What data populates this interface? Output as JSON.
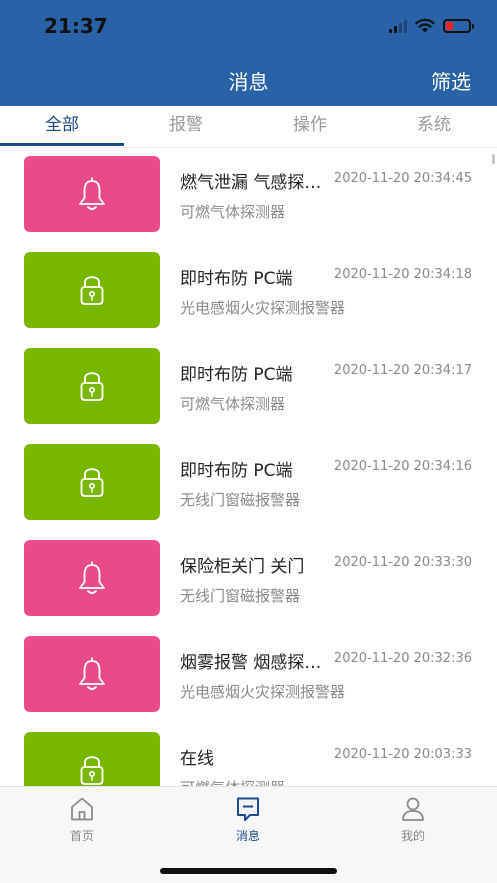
{
  "status_bar": {
    "time": "21:37",
    "battery_percent": 30
  },
  "header": {
    "title": "消息",
    "filter_label": "筛选"
  },
  "tabs": [
    {
      "label": "全部",
      "active": true
    },
    {
      "label": "报警",
      "active": false
    },
    {
      "label": "操作",
      "active": false
    },
    {
      "label": "系统",
      "active": false
    }
  ],
  "messages": [
    {
      "type": "alarm",
      "icon": "bell-icon",
      "title": "燃气泄漏  气感探测器",
      "time": "2020-11-20 20:34:45",
      "device": "可燃气体探测器"
    },
    {
      "type": "operation",
      "icon": "lock-icon",
      "title": "即时布防   PC端",
      "time": "2020-11-20 20:34:18",
      "device": "光电感烟火灾探测报警器"
    },
    {
      "type": "operation",
      "icon": "lock-icon",
      "title": "即时布防   PC端",
      "time": "2020-11-20 20:34:17",
      "device": "可燃气体探测器"
    },
    {
      "type": "operation",
      "icon": "lock-icon",
      "title": "即时布防   PC端",
      "time": "2020-11-20 20:34:16",
      "device": "无线门窗磁报警器"
    },
    {
      "type": "alarm",
      "icon": "bell-icon",
      "title": "保险柜关门  关门",
      "time": "2020-11-20 20:33:30",
      "device": "无线门窗磁报警器"
    },
    {
      "type": "alarm",
      "icon": "bell-icon",
      "title": "烟雾报警  烟感探测器",
      "time": "2020-11-20 20:32:36",
      "device": "光电感烟火灾探测报警器"
    },
    {
      "type": "operation",
      "icon": "lock-icon",
      "title": "在线",
      "time": "2020-11-20 20:03:33",
      "device": "可燃气体探测器"
    }
  ],
  "bottom_nav": [
    {
      "label": "首页",
      "icon": "home-icon",
      "active": false
    },
    {
      "label": "消息",
      "icon": "message-icon",
      "active": true
    },
    {
      "label": "我的",
      "icon": "user-icon",
      "active": false
    }
  ],
  "colors": {
    "header": "#2a62a7",
    "accent": "#1e4a8c",
    "alarm": "#e84a8a",
    "operation": "#7ab800"
  }
}
